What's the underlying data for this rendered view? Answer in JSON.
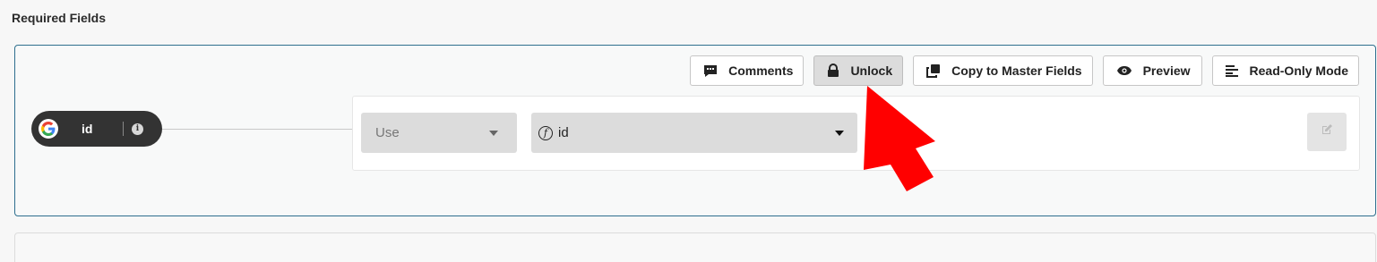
{
  "section": {
    "title": "Required Fields"
  },
  "toolbar": {
    "comments": "Comments",
    "unlock": "Unlock",
    "copy": "Copy to Master Fields",
    "preview": "Preview",
    "readonly": "Read-Only Mode"
  },
  "field": {
    "source_icon": "google-icon",
    "label": "id",
    "info": "i"
  },
  "mapping": {
    "mode": {
      "value": "Use",
      "icon": "chevron-down-icon"
    },
    "target": {
      "icon": "function-icon",
      "value": "id"
    },
    "edit_icon": "pencil-edit-icon"
  },
  "colors": {
    "accent_border": "#2e6f8e",
    "arrow": "#ff0000",
    "pill": "#333333"
  }
}
